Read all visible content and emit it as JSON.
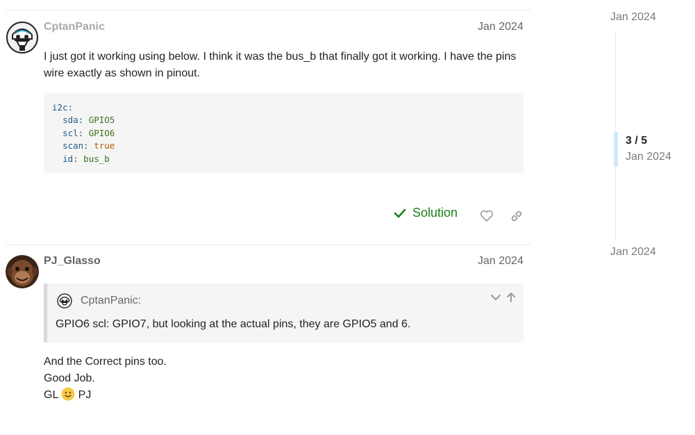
{
  "posts": [
    {
      "username": "CptanPanic",
      "date": "Jan 2024",
      "text_line1": "I just got it working using below. I think it was the bus_b that finally got it working. I have the pins",
      "text_line2": "wire exactly as shown in pinout.",
      "code": {
        "root_key": "i2c:",
        "lines": [
          {
            "key": "sda:",
            "value": "GPIO5"
          },
          {
            "key": "scl:",
            "value": "GPIO6"
          },
          {
            "key": "scan:",
            "value": "true"
          },
          {
            "key": "id:",
            "value": "bus_b"
          }
        ]
      },
      "solution_label": "Solution",
      "like_icon": "heart-icon",
      "share_icon": "link-icon"
    },
    {
      "username": "PJ_Glasso",
      "date": "Jan 2024",
      "quote": {
        "author": "CptanPanic:",
        "text": "GPIO6 scl: GPIO7, but looking at the actual pins, they are GPIO5 and 6."
      },
      "lines": [
        "And the Correct pins too.",
        "Good Job."
      ],
      "sign_prefix": "GL",
      "sign_suffix": "PJ"
    }
  ],
  "timeline": {
    "top_date": "Jan 2024",
    "position": "3 / 5",
    "position_date": "Jan 2024",
    "bottom_date": "Jan 2024"
  },
  "colors": {
    "accent": "#1a7f1a",
    "timeline": "#cfe8fb"
  }
}
